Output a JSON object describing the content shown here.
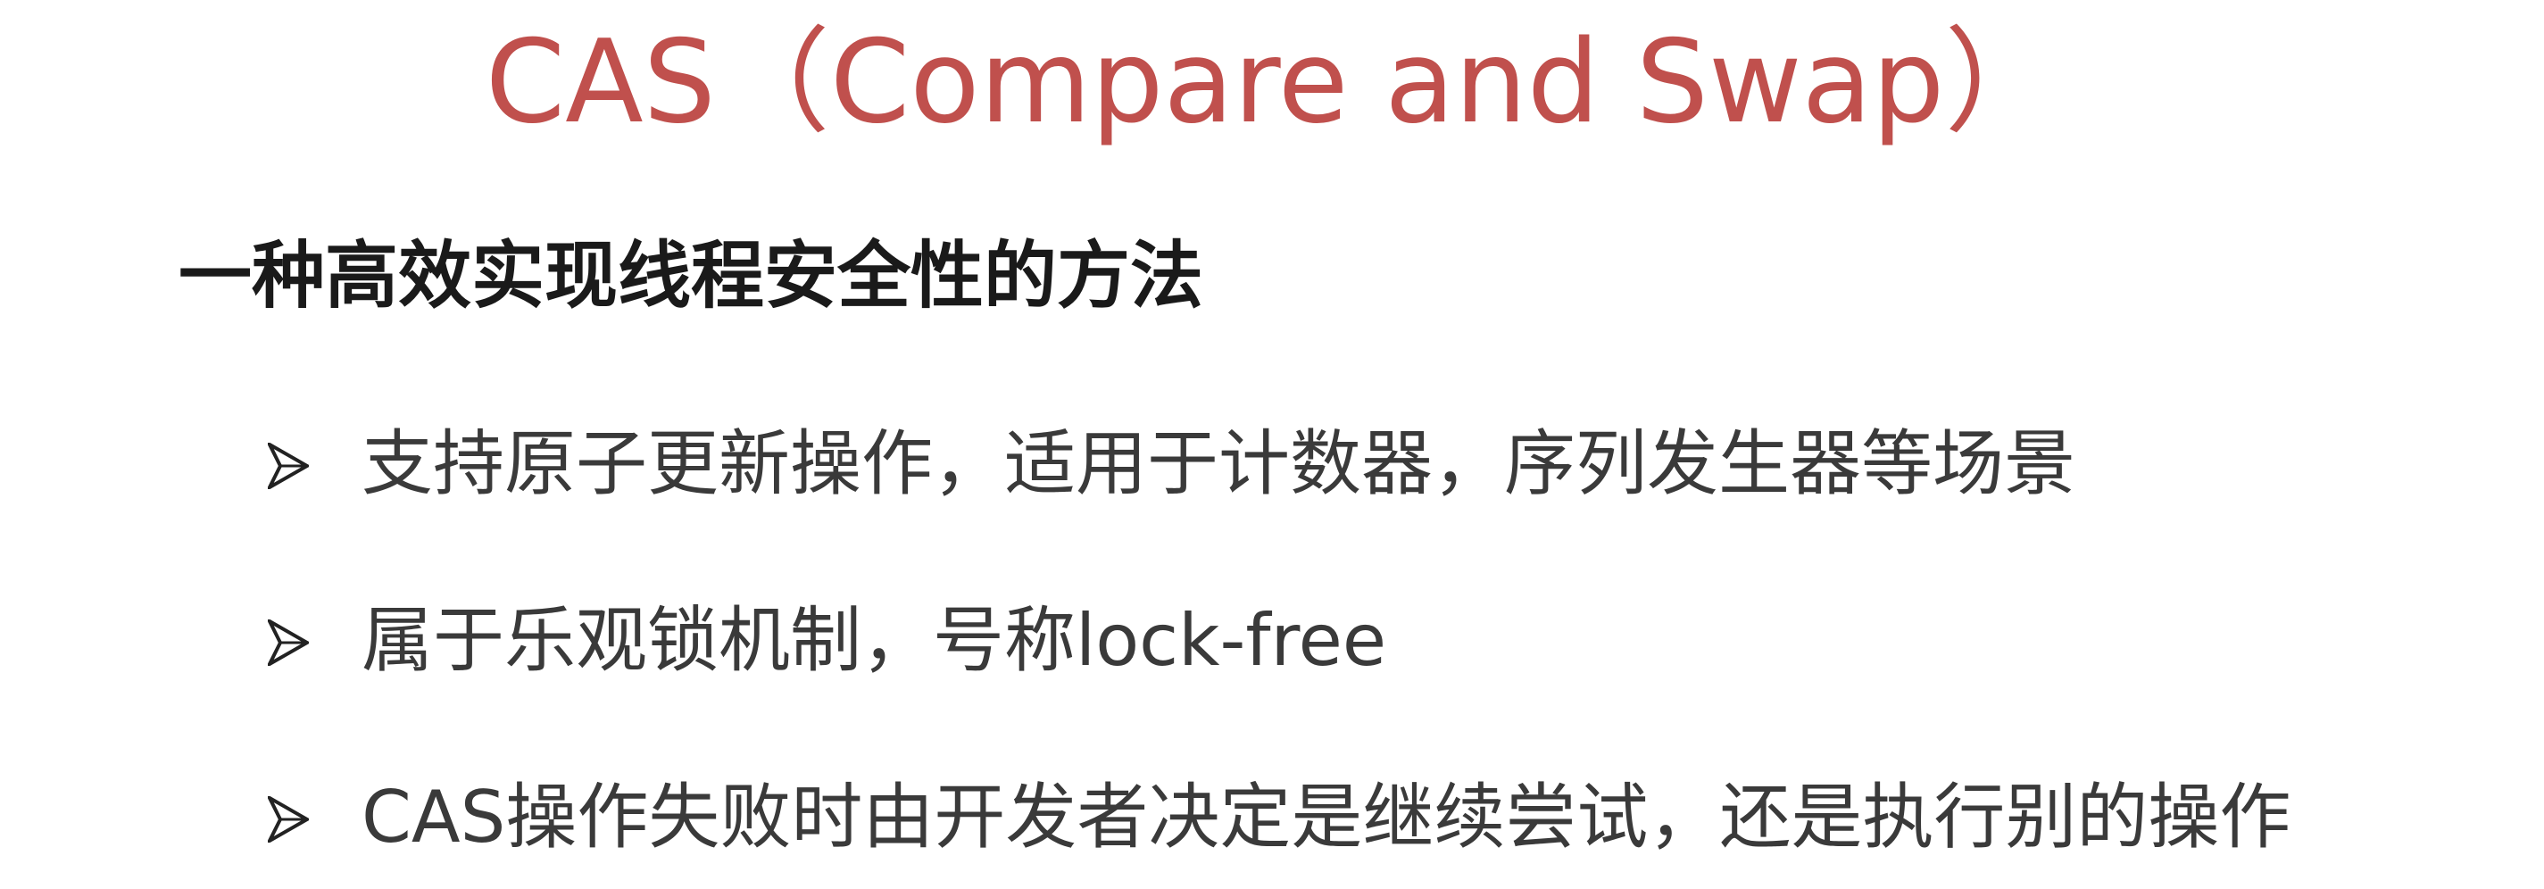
{
  "slide": {
    "title": "CAS（Compare and Swap）",
    "subtitle": "一种高效实现线程安全性的方法",
    "bullets": [
      {
        "text": "支持原子更新操作，适用于计数器，序列发生器等场景",
        "icon": "arrow-bullet-icon"
      },
      {
        "text": "属于乐观锁机制，号称lock-free",
        "icon": "arrow-bullet-icon"
      },
      {
        "text": "CAS操作失败时由开发者决定是继续尝试，还是执行别的操作",
        "icon": "arrow-bullet-icon"
      }
    ]
  },
  "colors": {
    "title": "#c0504d",
    "subtitle": "#1a1a1a",
    "bullet_text": "#3a3a3a",
    "background": "#ffffff"
  }
}
